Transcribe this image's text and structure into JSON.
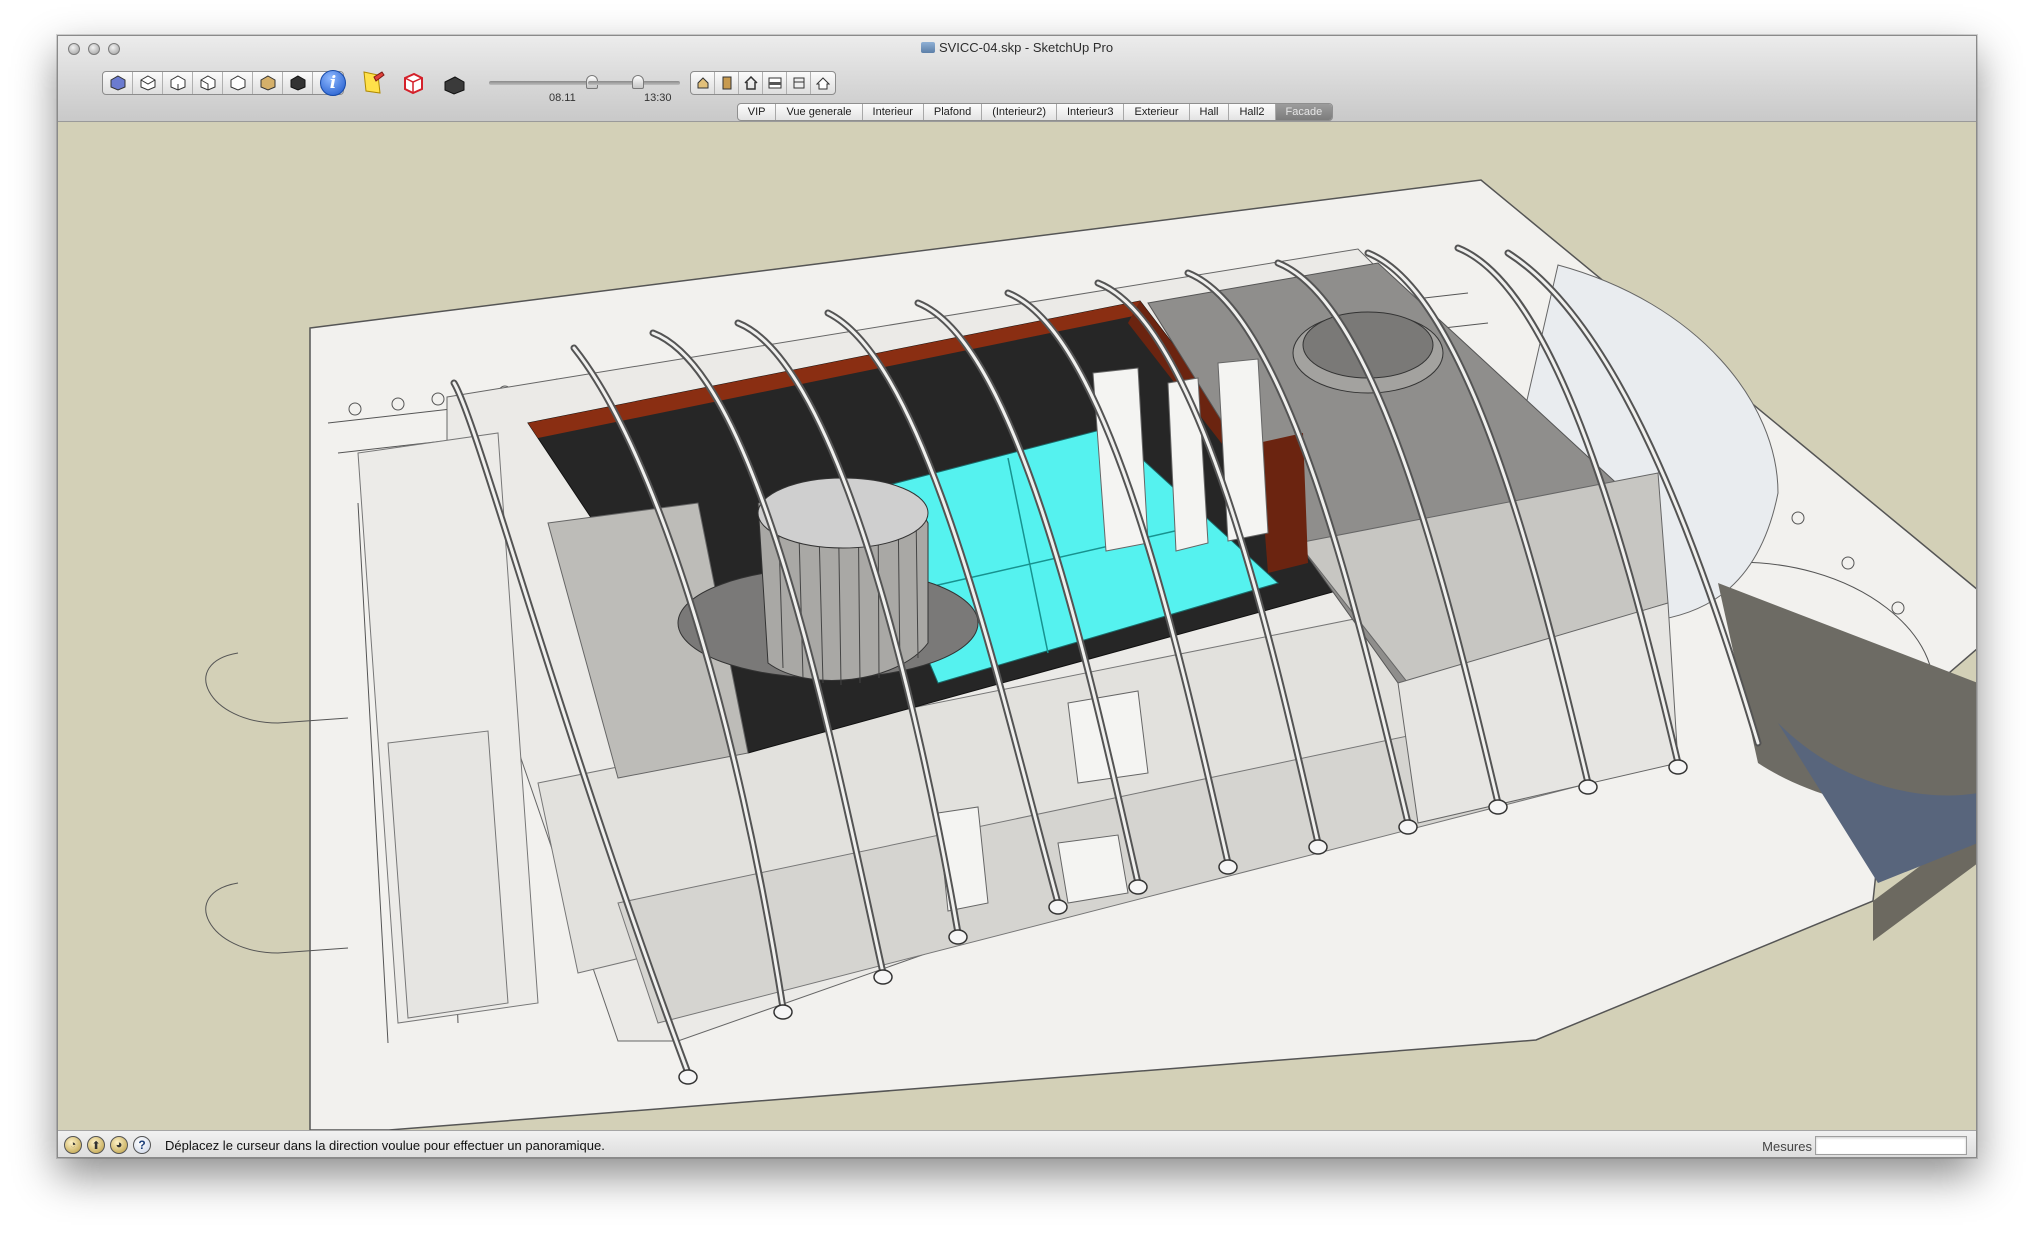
{
  "window": {
    "title": "SVICC-04.skp - SketchUp Pro"
  },
  "toolbar": {
    "view_buttons": [
      "iso-view-icon",
      "top-view-icon",
      "front-view-icon",
      "right-view-icon",
      "back-view-icon",
      "left-view-icon",
      "bottom-view-icon"
    ],
    "style_buttons": [
      "xray-icon",
      "shaded-icon",
      "monochrome-icon"
    ],
    "time_slider": {
      "label": "08.11",
      "value_fraction": 0.78
    },
    "date_slider": {
      "label": "13:30",
      "value_fraction": 0.55
    },
    "nav_buttons": [
      "house-icon",
      "door-icon",
      "home-icon",
      "section-icon",
      "window-icon",
      "roof-icon"
    ]
  },
  "scene_tabs": [
    {
      "label": "VIP",
      "active": false
    },
    {
      "label": "Vue generale",
      "active": false
    },
    {
      "label": "Interieur",
      "active": false
    },
    {
      "label": "Plafond",
      "active": false
    },
    {
      "label": "(Interieur2)",
      "active": false
    },
    {
      "label": "Interieur3",
      "active": false
    },
    {
      "label": "Exterieur",
      "active": false
    },
    {
      "label": "Hall",
      "active": false
    },
    {
      "label": "Hall2",
      "active": false
    },
    {
      "label": "Facade",
      "active": true
    }
  ],
  "statusbar": {
    "message": "Déplacez le curseur dans la direction voulue pour effectuer un panoramique.",
    "measure_label": "Mesures",
    "measure_value": ""
  },
  "colors": {
    "background": "#d3d0b7",
    "floor_highlight": "#55f2ef",
    "wall_red": "#8a2e12",
    "plan_sheet": "#f2f1ee"
  }
}
